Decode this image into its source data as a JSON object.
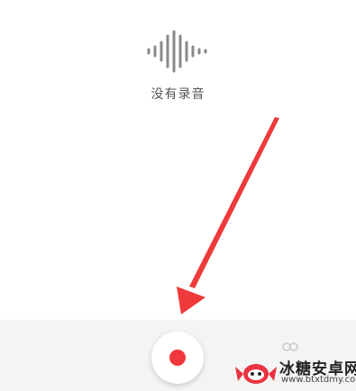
{
  "empty_state": {
    "message": "没有录音",
    "icon": "waveform-icon"
  },
  "bottom_bar": {
    "record_icon": "record-icon",
    "list_icon": "recordings-list-icon"
  },
  "colors": {
    "accent": "#f0373c",
    "icon_gray": "#8a8a8a",
    "bar_bg": "#f4f4f4"
  },
  "watermark": {
    "title": "冰糖安卓网",
    "url": "www.btxtdmy.com"
  }
}
